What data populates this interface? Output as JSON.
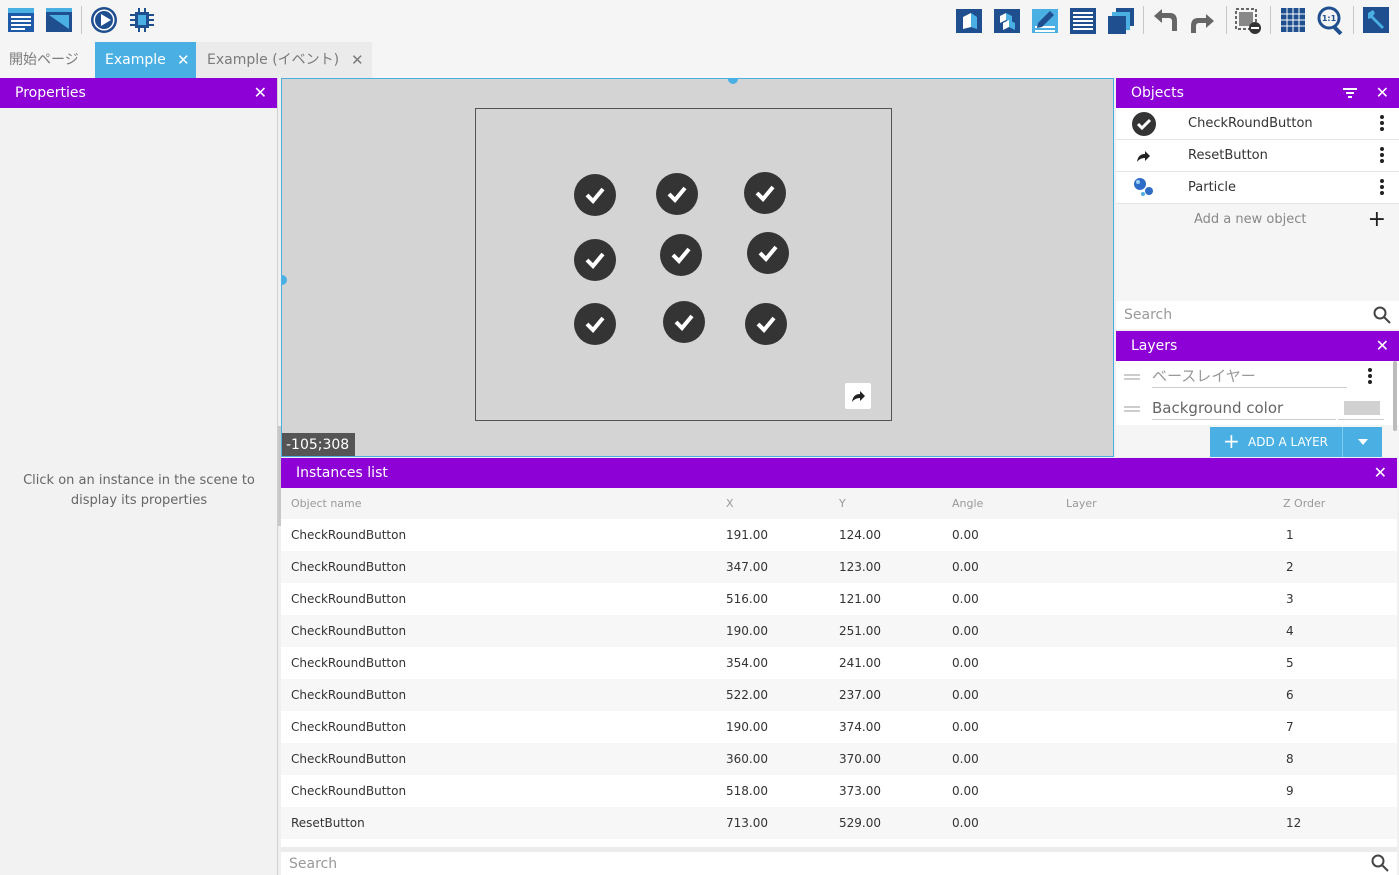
{
  "tabs": [
    {
      "label": "開始ページ",
      "closable": false,
      "active": false
    },
    {
      "label": "Example",
      "close_glyph": "✕",
      "active": true
    },
    {
      "label": "Example (イベント)",
      "close_glyph": "✕",
      "active": false
    }
  ],
  "toolbar": {
    "left_icons": [
      "project-manager-icon",
      "scene-editor-icon",
      "preview-play-icon",
      "debugger-chip-icon"
    ],
    "right_icons": [
      "object-groups-icon",
      "objects-list-icon",
      "properties-edit-icon",
      "instances-list-icon",
      "layers-icon",
      "undo-icon",
      "redo-icon",
      "delete-selection-icon",
      "grid-icon",
      "zoom-reset-icon",
      "settings-wrench-icon"
    ]
  },
  "properties": {
    "title": "Properties",
    "close_glyph": "✕",
    "hint": "Click on an instance in the scene to display its properties"
  },
  "scene": {
    "coord_readout": "-105;308"
  },
  "objects": {
    "title": "Objects",
    "close_glyph": "✕",
    "items": [
      {
        "name": "CheckRoundButton",
        "icon": "check-circle-icon"
      },
      {
        "name": "ResetButton",
        "icon": "share-arrow-icon"
      },
      {
        "name": "Particle",
        "icon": "particle-bubbles-icon"
      }
    ],
    "add_label": "Add a new object",
    "search_placeholder": "Search"
  },
  "layers": {
    "title": "Layers",
    "close_glyph": "✕",
    "base_layer_name": "ベースレイヤー",
    "background_label": "Background color",
    "background_color": "#d1d1d1",
    "add_button_label": "ADD A LAYER"
  },
  "instances": {
    "title": "Instances list",
    "close_glyph": "✕",
    "columns": {
      "name": "Object name",
      "x": "X",
      "y": "Y",
      "angle": "Angle",
      "layer": "Layer",
      "z": "Z Order"
    },
    "rows": [
      {
        "name": "CheckRoundButton",
        "x": "191.00",
        "y": "124.00",
        "angle": "0.00",
        "layer": "",
        "z": "1"
      },
      {
        "name": "CheckRoundButton",
        "x": "347.00",
        "y": "123.00",
        "angle": "0.00",
        "layer": "",
        "z": "2"
      },
      {
        "name": "CheckRoundButton",
        "x": "516.00",
        "y": "121.00",
        "angle": "0.00",
        "layer": "",
        "z": "3"
      },
      {
        "name": "CheckRoundButton",
        "x": "190.00",
        "y": "251.00",
        "angle": "0.00",
        "layer": "",
        "z": "4"
      },
      {
        "name": "CheckRoundButton",
        "x": "354.00",
        "y": "241.00",
        "angle": "0.00",
        "layer": "",
        "z": "5"
      },
      {
        "name": "CheckRoundButton",
        "x": "522.00",
        "y": "237.00",
        "angle": "0.00",
        "layer": "",
        "z": "6"
      },
      {
        "name": "CheckRoundButton",
        "x": "190.00",
        "y": "374.00",
        "angle": "0.00",
        "layer": "",
        "z": "7"
      },
      {
        "name": "CheckRoundButton",
        "x": "360.00",
        "y": "370.00",
        "angle": "0.00",
        "layer": "",
        "z": "8"
      },
      {
        "name": "CheckRoundButton",
        "x": "518.00",
        "y": "373.00",
        "angle": "0.00",
        "layer": "",
        "z": "9"
      },
      {
        "name": "ResetButton",
        "x": "713.00",
        "y": "529.00",
        "angle": "0.00",
        "layer": "",
        "z": "12"
      }
    ],
    "search_placeholder": "Search"
  },
  "colors": {
    "panel_header": "#8d00d6",
    "accent": "#4ab0e4",
    "scene_bg": "#d4d4d4",
    "check_button": "#343434"
  }
}
